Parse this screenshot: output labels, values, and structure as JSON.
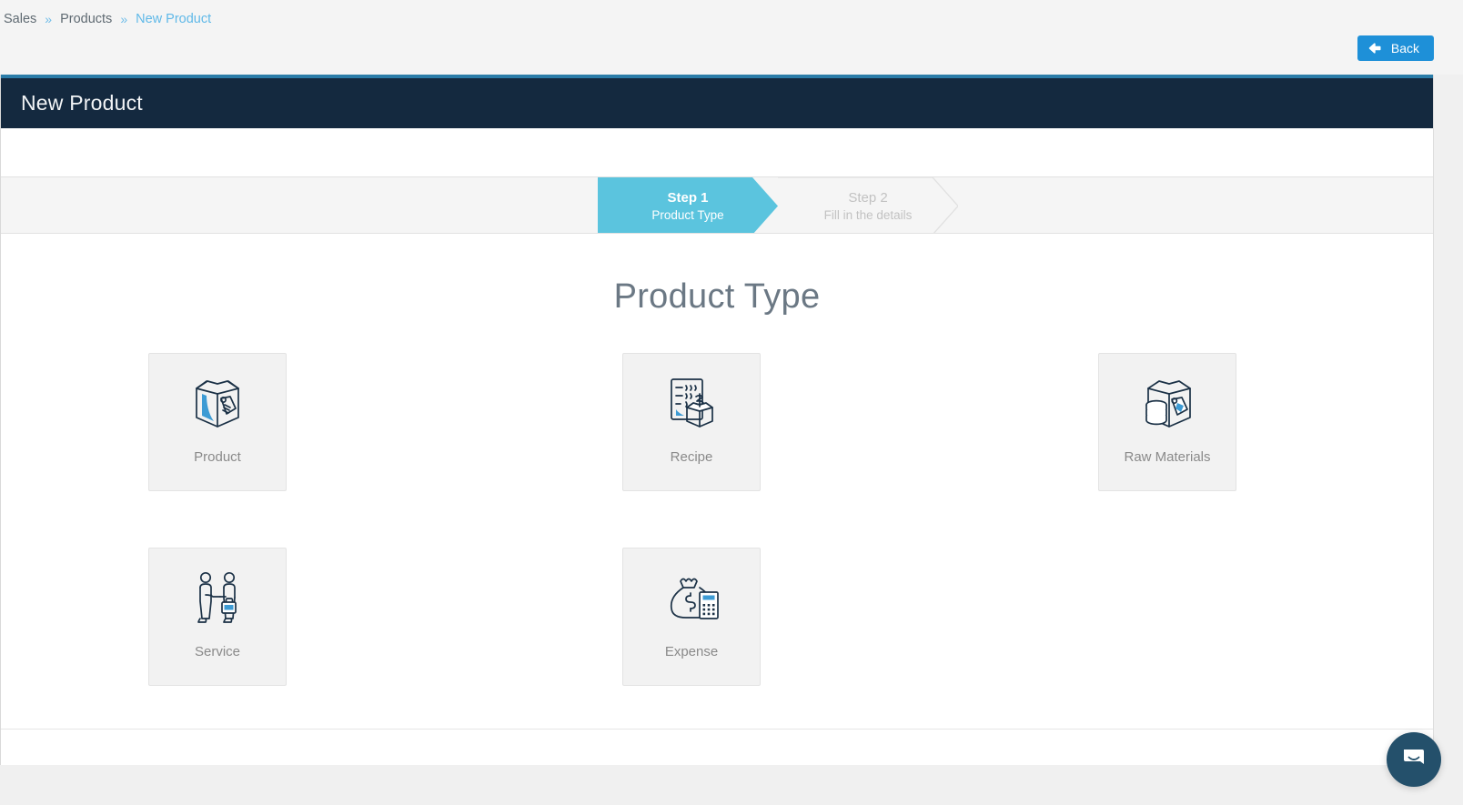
{
  "breadcrumb": {
    "items": [
      {
        "label": "Sales",
        "current": false
      },
      {
        "label": "Products",
        "current": false
      },
      {
        "label": "New Product",
        "current": true
      }
    ],
    "separator": "»"
  },
  "toolbar": {
    "back_label": "Back",
    "back_icon": "arrow-left-icon",
    "back_color": "#1e90d8"
  },
  "panel": {
    "title": "New Product",
    "header_color": "#14293f",
    "accent_color": "#2b7ca8"
  },
  "wizard": {
    "active_color": "#5bc4de",
    "inactive_color": "#c2c2c2",
    "steps": [
      {
        "title": "Step 1",
        "subtitle": "Product Type",
        "state": "active"
      },
      {
        "title": "Step 2",
        "subtitle": "Fill in the details",
        "state": "inactive"
      }
    ]
  },
  "main": {
    "section_title": "Product Type",
    "cards": [
      {
        "label": "Product",
        "icon": "box-with-tag-icon"
      },
      {
        "label": "Recipe",
        "icon": "document-with-box-icon"
      },
      {
        "label": "Raw Materials",
        "icon": "box-with-coins-icon"
      },
      {
        "label": "Service",
        "icon": "handshake-briefcase-icon"
      },
      {
        "label": "Expense",
        "icon": "money-bag-calculator-icon"
      }
    ]
  },
  "chat": {
    "icon": "chat-bubble-smile-icon",
    "color": "#24506b"
  }
}
